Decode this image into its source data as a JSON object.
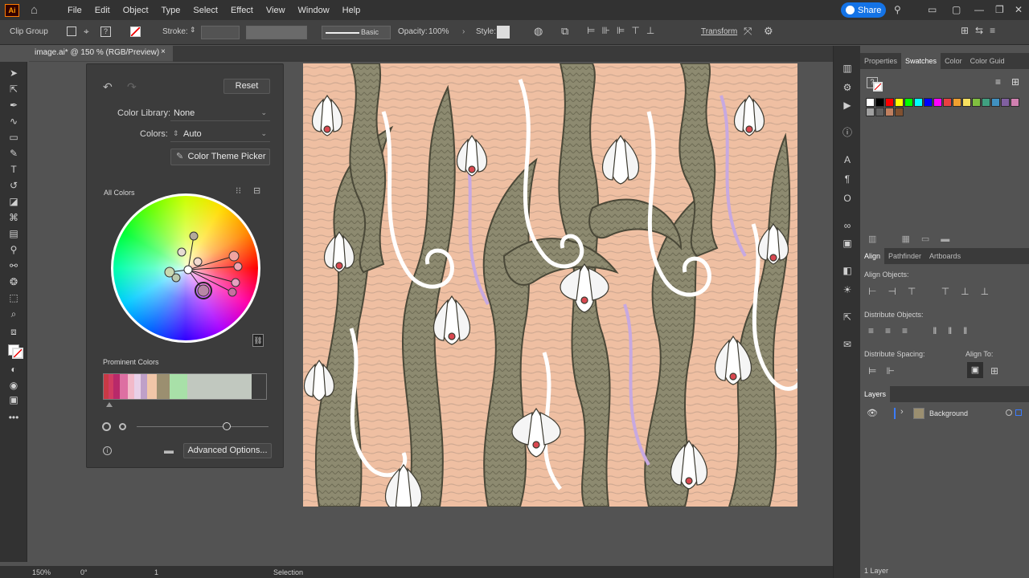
{
  "app": {
    "logo": "Ai"
  },
  "menu": [
    "File",
    "Edit",
    "Object",
    "Type",
    "Select",
    "Effect",
    "View",
    "Window",
    "Help"
  ],
  "share_label": "Share",
  "control": {
    "selection_type": "Clip Group",
    "stroke_label": "Stroke:",
    "brush_label": "Basic",
    "opacity_label": "Opacity:",
    "opacity_value": "100%",
    "style_label": "Style:",
    "transform_label": "Transform"
  },
  "document_tab": {
    "title": "image.ai* @ 150 % (RGB/Preview)",
    "close": "×"
  },
  "recolor": {
    "reset_label": "Reset",
    "color_library_label": "Color Library:",
    "color_library_value": "None",
    "colors_label": "Colors:",
    "colors_value": "Auto",
    "theme_picker_label": "Color Theme Picker",
    "all_colors_label": "All Colors",
    "prominent_label": "Prominent Colors",
    "advanced_label": "Advanced Options...",
    "prominent_colors": [
      "#c83a46",
      "#d13c62",
      "#b8296a",
      "#dd6fa2",
      "#f2b9c9",
      "#e8d0e8",
      "#bfa0c8",
      "#f1c6a8",
      "#9b8f70",
      "#a8e0a8",
      "#c1c8bf"
    ]
  },
  "panels": {
    "tabs": [
      "Properties",
      "Swatches",
      "Color",
      "Color Guid"
    ],
    "active_tab": "Swatches",
    "align_tabs": [
      "Align",
      "Pathfinder",
      "Artboards"
    ],
    "align_objects": "Align Objects:",
    "distribute_objects": "Distribute Objects:",
    "distribute_spacing": "Distribute Spacing:",
    "align_to": "Align To:",
    "layers_tab": "Layers",
    "layer_name": "Background",
    "layer_count": "1 Layer"
  },
  "swatch_colors": [
    "#ffffff",
    "#000000",
    "#ff0000",
    "#ffff00",
    "#00ff00",
    "#00ffff",
    "#0000ff",
    "#ff00ff",
    "#e84040",
    "#f0a030",
    "#f8e060",
    "#80c040",
    "#40a080",
    "#4090c0",
    "#8060a0",
    "#d080b0",
    "#a0a0a0",
    "#606060",
    "#c08060",
    "#805030"
  ],
  "status": {
    "zoom": "150%",
    "rotation": "0°",
    "artboard": "1",
    "tool": "Selection"
  }
}
